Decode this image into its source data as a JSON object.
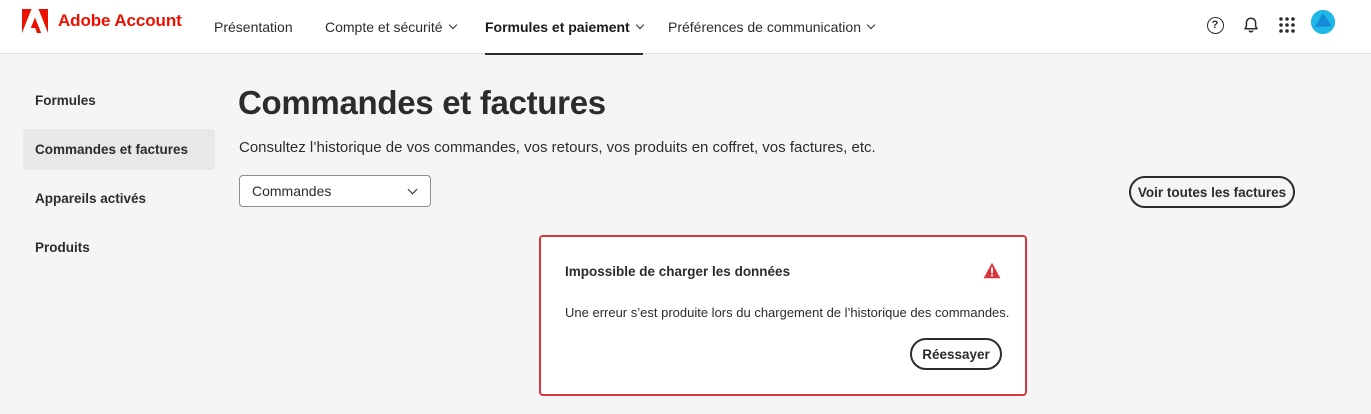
{
  "header": {
    "brand": "Adobe Account",
    "nav": [
      {
        "label": "Présentation",
        "has_caret": false,
        "active": false
      },
      {
        "label": "Compte et sécurité",
        "has_caret": true,
        "active": false
      },
      {
        "label": "Formules et paiement",
        "has_caret": true,
        "active": true
      },
      {
        "label": "Préférences de communication",
        "has_caret": true,
        "active": false
      }
    ],
    "icons": [
      "help-icon",
      "bell-icon",
      "apps-grid-icon",
      "avatar"
    ],
    "brand_color": "#eb1000"
  },
  "sidebar": {
    "items": [
      {
        "label": "Formules",
        "selected": false
      },
      {
        "label": "Commandes et factures",
        "selected": true
      },
      {
        "label": "Appareils activés",
        "selected": false
      },
      {
        "label": "Produits",
        "selected": false
      }
    ]
  },
  "main": {
    "title": "Commandes et factures",
    "subtitle": "Consultez l’historique de vos commandes, vos retours, vos produits en coffret, vos factures, etc.",
    "filter_selected": "Commandes",
    "view_all_button": "Voir toutes les factures"
  },
  "error": {
    "title": "Impossible de charger les données",
    "message": "Une erreur s’est produite lors du chargement de l’historique des commandes.",
    "retry_button": "Réessayer",
    "border_color": "#d7373f"
  }
}
